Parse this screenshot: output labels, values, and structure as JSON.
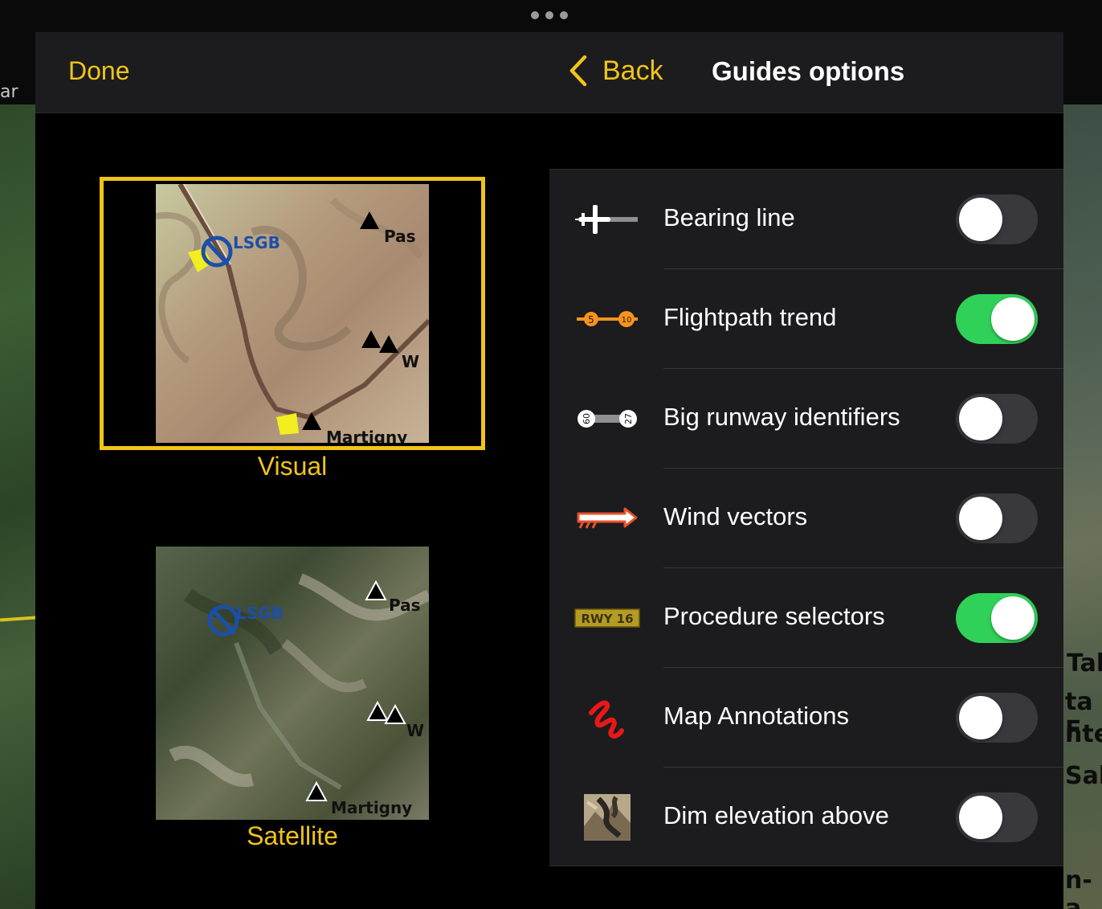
{
  "nav": {
    "done_label": "Done",
    "back_label": "Back",
    "title": "Guides options"
  },
  "map_styles": [
    {
      "label": "Visual",
      "selected": true
    },
    {
      "label": "Satellite",
      "selected": false
    }
  ],
  "map_thumbnail_labels": {
    "airport": "LSGB",
    "peak_1": "Pas",
    "peak_2": "W",
    "town": "Martigny"
  },
  "options": [
    {
      "label": "Bearing line",
      "icon": "bearing-line-icon",
      "on": false
    },
    {
      "label": "Flightpath trend",
      "icon": "flightpath-trend-icon",
      "on": true,
      "icon_text": [
        "5",
        "10"
      ]
    },
    {
      "label": "Big runway identifiers",
      "icon": "runway-identifier-icon",
      "on": false,
      "icon_text": [
        "09",
        "27"
      ]
    },
    {
      "label": "Wind vectors",
      "icon": "wind-vector-icon",
      "on": false
    },
    {
      "label": "Procedure selectors",
      "icon": "procedure-selector-icon",
      "on": true,
      "icon_text": [
        "RWY 16"
      ]
    },
    {
      "label": "Map Annotations",
      "icon": "annotation-scribble-icon",
      "on": false
    },
    {
      "label": "Dim elevation above",
      "icon": "terrain-elevation-icon",
      "on": false
    }
  ],
  "background": {
    "left_text": "ar",
    "right_labels": [
      "Tal",
      "ta F",
      "nte",
      "Sab",
      "n-a"
    ]
  },
  "colors": {
    "accent": "#f0c419",
    "toggle_on": "#30d158",
    "toggle_off": "#39393d",
    "panel": "#1c1c1e"
  }
}
